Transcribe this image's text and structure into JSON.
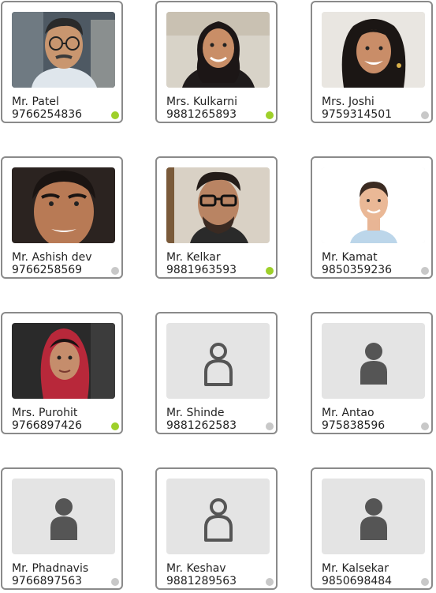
{
  "colors": {
    "online": "#9ed02a",
    "offline": "#c8c8c8",
    "border": "#8a8a8a",
    "placeholder_bg": "#e4e4e4"
  },
  "contacts": [
    {
      "name": "Mr. Patel",
      "phone": "9766254836",
      "status": "online",
      "avatar": "photo-man-glasses"
    },
    {
      "name": "Mrs. Kulkarni",
      "phone": "9881265893",
      "status": "online",
      "avatar": "photo-woman-smiling"
    },
    {
      "name": "Mrs. Joshi",
      "phone": "9759314501",
      "status": "offline",
      "avatar": "photo-woman-smiling"
    },
    {
      "name": "Mr. Ashish dev",
      "phone": "9766258569",
      "status": "offline",
      "avatar": "photo-man"
    },
    {
      "name": "Mr. Kelkar",
      "phone": "9881963593",
      "status": "online",
      "avatar": "photo-man-glasses"
    },
    {
      "name": "Mr. Kamat",
      "phone": "9850359236",
      "status": "offline",
      "avatar": "photo-man"
    },
    {
      "name": "Mrs. Purohit",
      "phone": "9766897426",
      "status": "online",
      "avatar": "photo-woman-scarf"
    },
    {
      "name": "Mr. Shinde",
      "phone": "9881262583",
      "status": "offline",
      "avatar": "user-outline-icon"
    },
    {
      "name": "Mr. Antao",
      "phone": "975838596",
      "status": "offline",
      "avatar": "user-filled-icon"
    },
    {
      "name": "Mr. Phadnavis",
      "phone": "9766897563",
      "status": "offline",
      "avatar": "user-filled-icon"
    },
    {
      "name": "Mr. Keshav",
      "phone": "9881289563",
      "status": "offline",
      "avatar": "user-outline-icon"
    },
    {
      "name": "Mr. Kalsekar",
      "phone": "9850698484",
      "status": "offline",
      "avatar": "user-filled-icon"
    }
  ]
}
